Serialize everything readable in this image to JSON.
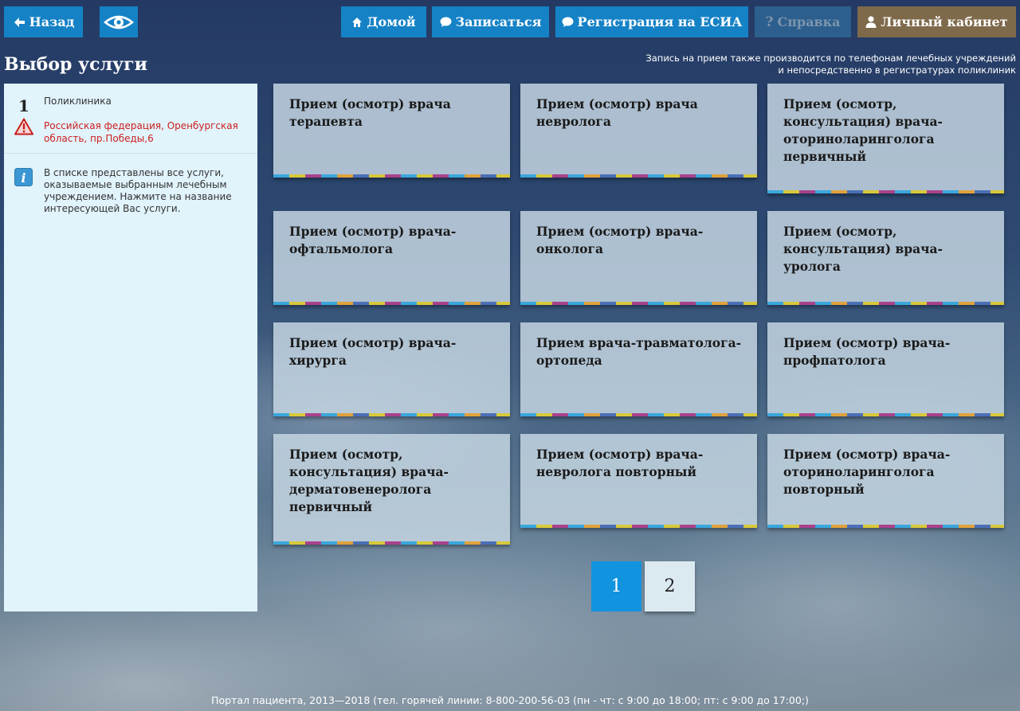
{
  "topbar": {
    "back_label": "Назад",
    "home_label": "Домой",
    "book_label": "Записаться",
    "esia_label": "Регистрация на ЕСИА",
    "help_label": "Справка",
    "cabinet_label": "Личный кабинет"
  },
  "page_title": "Выбор услуги",
  "notice": {
    "line1": "Запись на прием также производится по телефонам лечебных учреждений",
    "line2": "и непосредственно в регистратурах поликлиник"
  },
  "sidebar": {
    "step_number": "1",
    "org_type": "Поликлиника",
    "address": "Российская федерация, Оренбургская область, пр.Победы,6",
    "info_text": "В списке представлены все услуги, оказываемые выбранным лечебным учреждением. Нажмите на название интересующей Вас услуги."
  },
  "services": [
    "Прием (осмотр) врача терапевта",
    "Прием (осмотр) врача невролога",
    "Прием (осмотр, консультация) врача-оториноларинголога первичный",
    "Прием (осмотр) врача-офтальмолога",
    "Прием (осмотр) врача-онколога",
    "Прием (осмотр, консультация) врача-уролога",
    "Прием (осмотр) врача-хирурга",
    "Прием врача-травматолога-ортопеда",
    "Прием (осмотр) врача-профпатолога",
    "Прием (осмотр, консультация) врача-дерматовенеролога первичный",
    "Прием (осмотр) врача-невролога повторный",
    "Прием (осмотр) врача-оториноларинголога повторный"
  ],
  "pagination": {
    "page1": "1",
    "page2": "2",
    "current": 1
  },
  "footer": "Портал пациента, 2013—2018 (тел. горячей линии: 8-800-200-56-03 (пн - чт: с 9:00 до 18:00; пт: с 9:00 до 17:00;)",
  "colors": {
    "primary": "#1582c6",
    "cabinet": "#7e6a4b",
    "active_page": "#1293df"
  }
}
